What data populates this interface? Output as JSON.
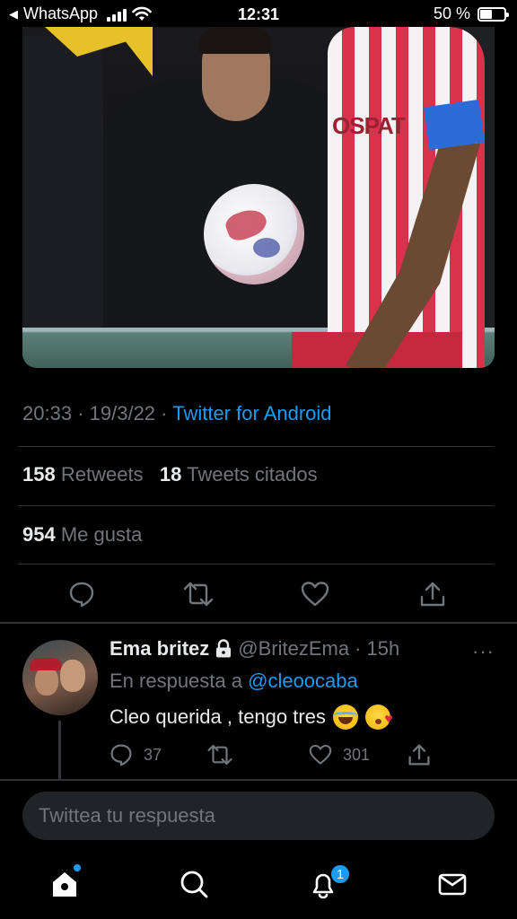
{
  "status_bar": {
    "back_label": "◀",
    "app_name": "WhatsApp",
    "time": "12:31",
    "battery_text": "50 %",
    "battery_level": 0.5
  },
  "tweet": {
    "time": "20:33",
    "date": "19/3/22",
    "separator": "·",
    "source": "Twitter for Android",
    "retweets_count": "158",
    "retweets_label": "Retweets",
    "quotes_count": "18",
    "quotes_label": "Tweets citados",
    "likes_count": "954",
    "likes_label": "Me gusta",
    "media": {
      "sponsor_text": "OSPAT"
    },
    "actions": [
      "reply-icon",
      "retweet-icon",
      "like-icon",
      "share-icon"
    ]
  },
  "reply": {
    "name": "Ema britez",
    "handle": "@BritezEma",
    "age": "· 15h",
    "more": "···",
    "reply_to_prefix": "En respuesta a",
    "reply_to_mention": "@cleoocaba",
    "text": "Cleo querida , tengo tres",
    "emojis": [
      "face-with-tears-of-joy",
      "face-blowing-a-kiss"
    ],
    "reply_count": "37",
    "retweet_count": "",
    "like_count": "301"
  },
  "compose": {
    "placeholder": "Twittea tu respuesta"
  },
  "bottom_nav": {
    "items": [
      "home-icon",
      "search-icon",
      "notifications-icon",
      "messages-icon"
    ],
    "notifications_badge": "1"
  },
  "colors": {
    "accent": "#1d9bf0",
    "background": "#000000",
    "muted_text": "#71767b",
    "divider": "#2f3336"
  }
}
